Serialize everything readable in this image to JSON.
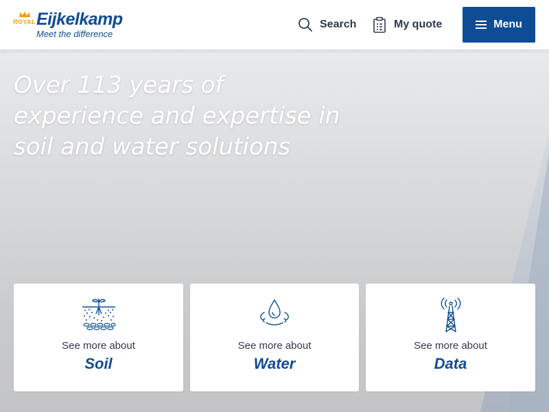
{
  "header": {
    "logo": {
      "royal": "ROYAL",
      "brand": "Eijkelkamp",
      "tagline": "Meet the difference"
    },
    "search_label": "Search",
    "quote_label": "My quote",
    "menu_label": "Menu"
  },
  "hero": {
    "title": "Over 113 years of experience and expertise in soil and water solutions"
  },
  "cards": [
    {
      "subtitle": "See more about",
      "title": "Soil",
      "icon": "soil-plant-icon"
    },
    {
      "subtitle": "See more about",
      "title": "Water",
      "icon": "water-drop-icon"
    },
    {
      "subtitle": "See more about",
      "title": "Data",
      "icon": "data-tower-icon"
    }
  ],
  "colors": {
    "brand_blue": "#0e4c96",
    "accent_orange": "#f2a01b",
    "nav_text": "#2e3a4a"
  }
}
